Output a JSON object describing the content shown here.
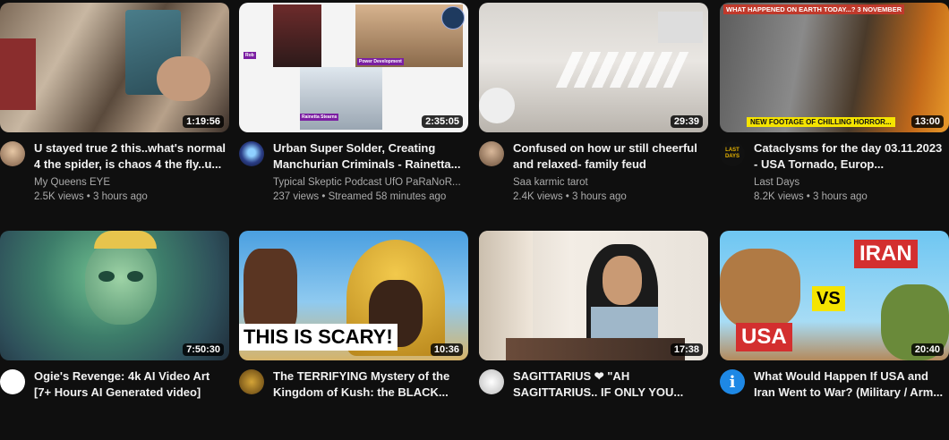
{
  "videos": [
    {
      "title": "U stayed true 2 this..what's normal 4 the spider, is chaos 4 the fly..u...",
      "channel": "My Queens EYE",
      "views": "2.5K views",
      "age": "3 hours ago",
      "duration": "1:19:56"
    },
    {
      "title": "Urban Super Solder, Creating Manchurian Criminals - Rainetta...",
      "channel": "Typical Skeptic Podcast UfO PaRaNoR...",
      "views": "237 views",
      "age": "Streamed 58 minutes ago",
      "duration": "2:35:05",
      "thumb_labels": [
        "Rob",
        "Power Development",
        "Rainetta Stearns"
      ]
    },
    {
      "title": "Confused on how ur still cheerful and relaxed- family feud",
      "channel": "Saa karmic tarot",
      "views": "2.4K views",
      "age": "3 hours ago",
      "duration": "29:39"
    },
    {
      "title": "Cataclysms for the day 03.11.2023 - USA Tornado, Europ...",
      "channel": "Last Days",
      "views": "8.2K views",
      "age": "3 hours ago",
      "duration": "13:00",
      "thumb_top": "WHAT HAPPENED ON EARTH TODAY...? 3 NOVEMBER",
      "thumb_bottom": "NEW FOOTAGE OF CHILLING HORROR...",
      "avatar_text": "LAST DAYS"
    },
    {
      "title": "Ogie's Revenge: 4k AI Video Art [7+ Hours AI Generated video]",
      "channel": "",
      "views": "",
      "age": "",
      "duration": "7:50:30"
    },
    {
      "title": "The TERRIFYING Mystery of the Kingdom of Kush: the BLACK...",
      "channel": "",
      "views": "",
      "age": "",
      "duration": "10:36",
      "thumb_text": "THIS IS SCARY!"
    },
    {
      "title": "SAGITTARIUS ❤ \"AH SAGITTARIUS.. IF ONLY YOU...",
      "channel": "",
      "views": "",
      "age": "",
      "duration": "17:38"
    },
    {
      "title": "What Would Happen If USA and Iran Went to War? (Military / Arm...",
      "channel": "",
      "views": "",
      "age": "",
      "duration": "20:40",
      "thumb_iran": "IRAN",
      "thumb_vs": "VS",
      "thumb_usa": "USA"
    }
  ],
  "icons": {
    "info_avatar": "i"
  }
}
